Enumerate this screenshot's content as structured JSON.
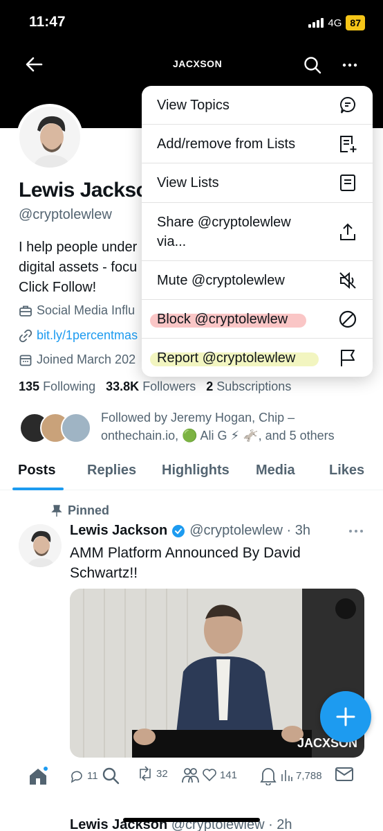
{
  "status_bar": {
    "time": "11:47",
    "network": "4G",
    "battery": "87"
  },
  "header": {
    "brand": "JACXSON"
  },
  "profile": {
    "display_name": "Lewis Jackso",
    "handle": "@cryptolewlew",
    "bio_lines": [
      "I help people under",
      "digital assets - focu",
      "Click Follow!"
    ],
    "category": "Social Media Influ",
    "link": "bit.ly/1percentmas",
    "joined": "Joined March 202",
    "following_count": "135",
    "following_label": "Following",
    "followers_count": "33.8K",
    "followers_label": "Followers",
    "subscriptions_count": "2",
    "subscriptions_label": "Subscriptions",
    "followed_by_line1": "Followed by Jeremy Hogan, Chip –",
    "followed_by_line2": "onthechain.io, 🟢 Ali G ⚡ 🫏, and 5 others"
  },
  "tabs": [
    "Posts",
    "Replies",
    "Highlights",
    "Media",
    "Likes"
  ],
  "post": {
    "pinned_label": "Pinned",
    "name": "Lewis Jackson",
    "meta": "@cryptolewlew · 3h",
    "text": "AMM Platform Announced By David Schwartz!!",
    "media_logo": "JACXSON",
    "replies": "11",
    "reposts": "32",
    "likes": "141",
    "views": "7,788"
  },
  "next_post": {
    "name": "Lewis Jackson",
    "meta": "@cryptolewlew · 2h"
  },
  "menu": {
    "items": [
      {
        "label": "View Topics",
        "icon": "topics-icon"
      },
      {
        "label": "Add/remove from Lists",
        "icon": "list-add-icon"
      },
      {
        "label": "View Lists",
        "icon": "list-icon"
      },
      {
        "label_line1": "Share @cryptolewlew",
        "label_line2": "via...",
        "icon": "share-icon"
      },
      {
        "label": "Mute @cryptolewlew",
        "icon": "mute-icon"
      },
      {
        "label": "Block @cryptolewlew",
        "icon": "block-icon"
      },
      {
        "label": "Report @cryptolewlew",
        "icon": "flag-icon"
      }
    ]
  },
  "colors": {
    "accent": "#1d9bf0",
    "block_highlight": "#f48080",
    "report_highlight": "#e8ec8c"
  }
}
